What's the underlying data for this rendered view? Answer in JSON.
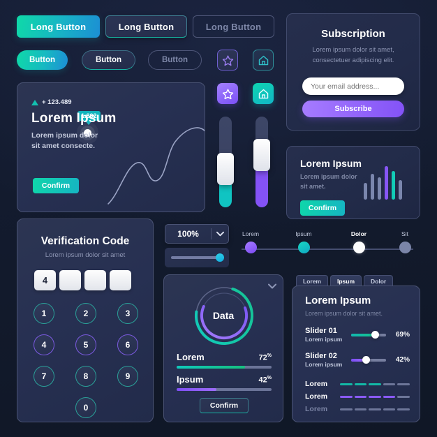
{
  "long_buttons": [
    {
      "label": "Long Button",
      "style": "filled"
    },
    {
      "label": "Long Button",
      "style": "outline"
    },
    {
      "label": "Long Button",
      "style": "ghost"
    }
  ],
  "pill_buttons": [
    {
      "label": "Button",
      "style": "filled"
    },
    {
      "label": "Button",
      "style": "outline"
    },
    {
      "label": "Button",
      "style": "ghost"
    }
  ],
  "icon_buttons": [
    {
      "icon": "star-icon",
      "style": "outline-purple"
    },
    {
      "icon": "home-icon",
      "style": "outline-teal"
    },
    {
      "icon": "star-icon",
      "style": "filled-purple"
    },
    {
      "icon": "home-icon",
      "style": "filled-teal"
    }
  ],
  "hero_card": {
    "change": "+ 123.489",
    "trend_icon": "triangle-up-icon",
    "title": "Lorem Ipsum",
    "description_line1": "Lorem ipsum dolor",
    "description_line2": "sit amet consecte.",
    "confirm_label": "Confirm",
    "tooltip_value": "1.802",
    "chart_data": {
      "type": "line",
      "title": "",
      "x": [
        0,
        1,
        2,
        3,
        4,
        5,
        6,
        7,
        8,
        9,
        10
      ],
      "y": [
        5,
        22,
        40,
        56,
        50,
        38,
        47,
        66,
        80,
        90,
        88
      ],
      "highlight_point": {
        "x": 7,
        "y": 66,
        "label": "1.802"
      },
      "xlabel": "",
      "ylabel": "",
      "grid": false,
      "legend": "none"
    }
  },
  "subscription": {
    "title": "Subscription",
    "desc_line1": "Lorem ipsum dolor sit amet,",
    "desc_line2": "consectetuer adipiscing elit.",
    "email_placeholder": "Your email address...",
    "email_value": "",
    "button_label": "Subscribe"
  },
  "mini_card": {
    "title": "Lorem Ipsum",
    "desc_line1": "Lorem ipsum dolor",
    "desc_line2": "sit amet.",
    "confirm_label": "Confirm",
    "chart_data": {
      "type": "bar",
      "categories": [
        "1",
        "2",
        "3",
        "4",
        "5",
        "6"
      ],
      "values": [
        26,
        40,
        34,
        52,
        44,
        30
      ],
      "colors": [
        "#7a86ad",
        "#7a86ad",
        "#7a86ad",
        "#8656f5",
        "#12cbb6",
        "#7a86ad"
      ],
      "title": "",
      "xlabel": "",
      "ylabel": "",
      "ylim": [
        0,
        56
      ],
      "grid": false
    }
  },
  "vertical_sliders": [
    {
      "name": "slider-teal",
      "value": 42,
      "color": "#10c4c2"
    },
    {
      "name": "slider-purple",
      "value": 58,
      "color": "#8452f6"
    }
  ],
  "verification": {
    "title": "Verification Code",
    "subtitle": "Lorem ipsum dolor sit amet",
    "code_inputs": [
      "4",
      "",
      "",
      ""
    ],
    "keys": [
      {
        "label": "1",
        "color": "teal"
      },
      {
        "label": "2",
        "color": "teal"
      },
      {
        "label": "3",
        "color": "teal"
      },
      {
        "label": "4",
        "color": "purple"
      },
      {
        "label": "5",
        "color": "purple"
      },
      {
        "label": "6",
        "color": "purple"
      },
      {
        "label": "7",
        "color": "teal"
      },
      {
        "label": "8",
        "color": "teal"
      },
      {
        "label": "9",
        "color": "teal"
      },
      {
        "label": "0",
        "color": "teal"
      }
    ]
  },
  "zoom_control": {
    "value": "100%",
    "chevron_icon": "chevron-down-icon",
    "slider_value": 100
  },
  "stepper": {
    "steps": [
      {
        "label": "Lorem",
        "state": "done",
        "color": "#8c5ff7"
      },
      {
        "label": "Ipsum",
        "state": "done",
        "color": "#12bcbb"
      },
      {
        "label": "Dolor",
        "state": "current",
        "color": "#ffffff"
      },
      {
        "label": "Sit",
        "state": "todo",
        "color": "#7b85a8"
      }
    ]
  },
  "donut_panel": {
    "chevron_icon": "chevron-down-icon",
    "center_label": "Data",
    "confirm_label": "Confirm",
    "chart_data": {
      "type": "pie",
      "title": "Data",
      "series": [
        {
          "name": "outer-ring",
          "value": 72,
          "color": "#12c7b5"
        },
        {
          "name": "inner-ring",
          "value": 62,
          "color": "#8a5af6"
        }
      ],
      "legend": "none"
    },
    "progress": [
      {
        "label": "Lorem",
        "value": 72,
        "unit": "%",
        "color_from": "#0fc9bb",
        "color_to": "#17c07f"
      },
      {
        "label": "Ipsum",
        "value": 42,
        "unit": "%",
        "color_from": "#7f4ef5",
        "color_to": "#9d6cf8"
      }
    ]
  },
  "tabs_panel": {
    "tabs": [
      {
        "label": "Lorem",
        "active": false
      },
      {
        "label": "Ipsum",
        "active": true
      },
      {
        "label": "Dolor",
        "active": false
      }
    ],
    "title": "Lorem Ipsum",
    "subtitle": "Lorem ipsum dolor sit amet.",
    "sliders": [
      {
        "name": "Slider 01",
        "sub": "Lorem ipsum",
        "value": 69,
        "display": "69%",
        "color_from": "#12b6b0",
        "color_to": "#15c58e"
      },
      {
        "name": "Slider 02",
        "sub": "Lorem ipsum",
        "value": 42,
        "display": "42%",
        "color_from": "#7b4ef4",
        "color_to": "#9a68f8"
      }
    ],
    "segment_rows": [
      {
        "label": "Lorem",
        "filled": 3,
        "total": 5,
        "color": "#13b9a6",
        "dim": false
      },
      {
        "label": "Lorem",
        "filled": 4,
        "total": 5,
        "color": "#8a5af6",
        "dim": false
      },
      {
        "label": "Lorem",
        "filled": 0,
        "total": 5,
        "color": "#6d7699",
        "dim": true
      }
    ]
  },
  "colors": {
    "background": "#121a2c",
    "panel": "#2a3352",
    "accent_teal": "#12c4b4",
    "accent_purple": "#8452f6",
    "accent_blue": "#1c8fd4",
    "text_muted": "#8e96b4"
  }
}
